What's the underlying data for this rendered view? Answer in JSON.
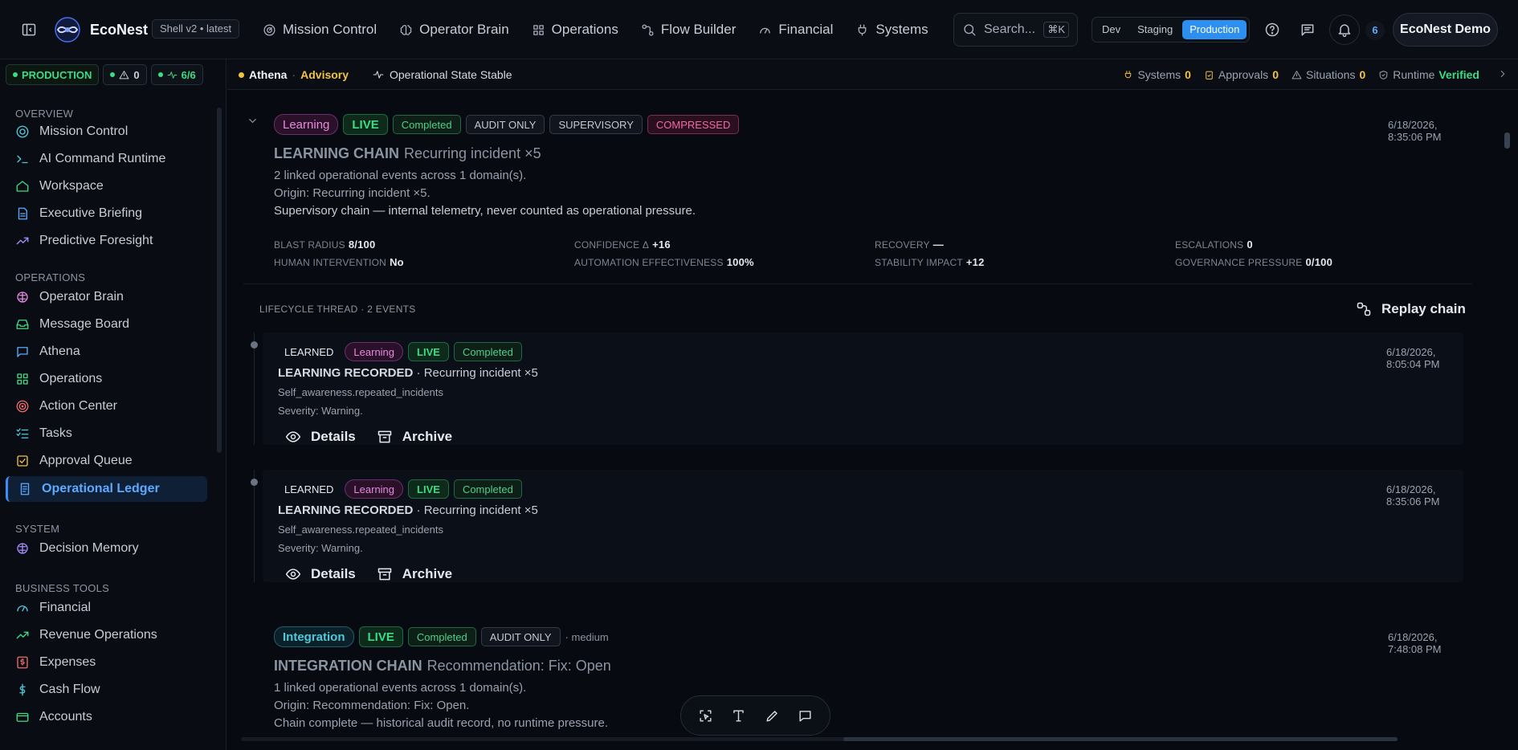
{
  "app": {
    "brand": "EcoNest",
    "shell": "Shell v2 • latest"
  },
  "nav": [
    {
      "label": "Mission Control",
      "icon": "gauge-icon"
    },
    {
      "label": "Operator Brain",
      "icon": "brain-icon"
    },
    {
      "label": "Operations",
      "icon": "grid-icon"
    },
    {
      "label": "Flow Builder",
      "icon": "flow-icon"
    },
    {
      "label": "Financial",
      "icon": "speedometer-icon"
    },
    {
      "label": "Systems",
      "icon": "plug-icon"
    }
  ],
  "search": {
    "placeholder": "Search...",
    "shortcut": "⌘K"
  },
  "env": {
    "dev": "Dev",
    "staging": "Staging",
    "production": "Production",
    "selected": "Production"
  },
  "notifications": {
    "count": "6"
  },
  "user": {
    "name": "EcoNest Demo"
  },
  "sidebar": {
    "status": {
      "env": "PRODUCTION",
      "alerts": "0",
      "health": "6/6"
    },
    "sections": {
      "overview": "OVERVIEW",
      "operations": "OPERATIONS",
      "system": "SYSTEM",
      "business": "BUSINESS TOOLS"
    },
    "overview": [
      "Mission Control",
      "AI Command Runtime",
      "Workspace",
      "Executive Briefing",
      "Predictive Foresight"
    ],
    "operations": [
      "Operator Brain",
      "Message Board",
      "Athena",
      "Operations",
      "Action Center",
      "Tasks",
      "Approval Queue",
      "Operational Ledger"
    ],
    "system": [
      "Decision Memory"
    ],
    "business": [
      "Financial",
      "Revenue Operations",
      "Expenses",
      "Cash Flow",
      "Accounts"
    ],
    "active": "Operational Ledger"
  },
  "strip": {
    "athena": "Athena",
    "sep": "·",
    "mode": "Advisory",
    "state": "Operational State Stable",
    "systems_label": "Systems",
    "systems_count": "0",
    "approvals_label": "Approvals",
    "approvals_count": "0",
    "situations_label": "Situations",
    "situations_count": "0",
    "runtime_label": "Runtime",
    "runtime_value": "Verified"
  },
  "chain1": {
    "badges": {
      "type": "Learning",
      "live": "LIVE",
      "status": "Completed",
      "audit": "AUDIT ONLY",
      "supervisory": "SUPERVISORY",
      "compressed": "COMPRESSED"
    },
    "timestamp": "6/18/2026, 8:35:06 PM",
    "title": "LEARNING CHAIN",
    "subtitle": "Recurring incident ×5",
    "line1": "2 linked operational events across 1 domain(s).",
    "line2": "Origin: Recurring incident ×5.",
    "line3": "Supervisory chain — internal telemetry, never counted as operational pressure.",
    "metrics": {
      "blast_label": "BLAST RADIUS",
      "blast": "8/100",
      "confidence_label": "CONFIDENCE Δ",
      "confidence": "+16",
      "recovery_label": "RECOVERY",
      "recovery": "—",
      "escalations_label": "ESCALATIONS",
      "escalations": "0",
      "human_label": "HUMAN INTERVENTION",
      "human": "No",
      "automation_label": "AUTOMATION EFFECTIVENESS",
      "automation": "100%",
      "stability_label": "STABILITY IMPACT",
      "stability": "+12",
      "governance_label": "GOVERNANCE PRESSURE",
      "governance": "0/100"
    },
    "lifecycle": "LIFECYCLE THREAD · 2 EVENTS",
    "replay": "Replay chain"
  },
  "events": [
    {
      "tag": "LEARNED",
      "type": "Learning",
      "live": "LIVE",
      "status": "Completed",
      "timestamp": "6/18/2026, 8:05:04 PM",
      "title": "LEARNING RECORDED",
      "title_sep": "·",
      "subtitle": "Recurring incident ×5",
      "source": "Self_awareness.repeated_incidents",
      "severity": "Severity: Warning.",
      "details": "Details",
      "archive": "Archive"
    },
    {
      "tag": "LEARNED",
      "type": "Learning",
      "live": "LIVE",
      "status": "Completed",
      "timestamp": "6/18/2026, 8:35:06 PM",
      "title": "LEARNING RECORDED",
      "title_sep": "·",
      "subtitle": "Recurring incident ×5",
      "source": "Self_awareness.repeated_incidents",
      "severity": "Severity: Warning.",
      "details": "Details",
      "archive": "Archive"
    }
  ],
  "chain2": {
    "badges": {
      "type": "Integration",
      "live": "LIVE",
      "status": "Completed",
      "audit": "AUDIT ONLY",
      "priority": "· medium"
    },
    "timestamp": "6/18/2026, 7:48:08 PM",
    "title": "INTEGRATION CHAIN",
    "subtitle": "Recommendation: Fix: Open",
    "line1": "1 linked operational events across 1 domain(s).",
    "line2": "Origin: Recommendation: Fix: Open.",
    "line3": "Chain complete — historical audit record, no runtime pressure."
  },
  "float_toolbar": [
    "select-icon",
    "text-icon",
    "pen-icon",
    "comment-icon"
  ]
}
